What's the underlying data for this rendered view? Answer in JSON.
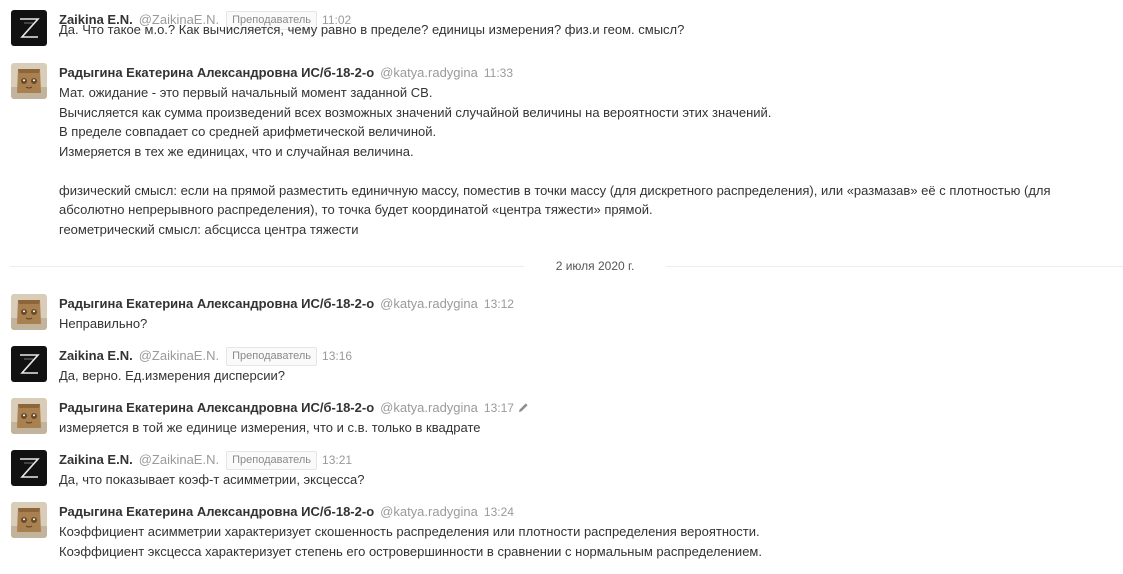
{
  "messages": [
    {
      "author": "Zaikina E.N.",
      "handle": "@ZaikinaE.N.",
      "role": "Преподаватель",
      "time": "11:02",
      "avatar": "teacher-logo-avatar",
      "lines": [
        "Да. Что такое м.о.? Как вычисляется, чему равно в пределе? единицы измерения? физ.и геом. смысл?"
      ]
    },
    {
      "author": "Радыгина Екатерина Александровна ИС/б-18-2-о",
      "handle": "@katya.radygina",
      "time": "11:33",
      "avatar": "student-photo-avatar",
      "lines": [
        "Мат. ожидание - это первый начальный момент заданной СВ.",
        "Вычисляется как сумма произведений всех возможных значений случайной величины на вероятности этих значений.",
        "В пределе совпадает со средней арифметической величиной.",
        "Измеряется в тех же единицах, что и случайная величина.",
        "",
        "физический смысл: если на прямой разместить единичную массу, поместив в точки массу (для дискретного распределения), или «размазав» её с плотностью (для",
        "абсолютно непрерывного распределения), то точка будет координатой «центра тяжести» прямой.",
        "геометрический смысл: абсцисса центра тяжести"
      ]
    },
    {
      "author": "Радыгина Екатерина Александровна ИС/б-18-2-о",
      "handle": "@katya.radygina",
      "time": "13:12",
      "avatar": "student-photo-avatar",
      "lines": [
        "Неправильно?"
      ]
    },
    {
      "author": "Zaikina E.N.",
      "handle": "@ZaikinaE.N.",
      "role": "Преподаватель",
      "time": "13:16",
      "avatar": "teacher-logo-avatar",
      "lines": [
        "Да, верно. Ед.измерения дисперсии?"
      ]
    },
    {
      "author": "Радыгина Екатерина Александровна ИС/б-18-2-о",
      "handle": "@katya.radygina",
      "time": "13:17",
      "edited": true,
      "avatar": "student-photo-avatar",
      "lines": [
        "измеряется в той же единице измерения, что и с.в. только в квадрате"
      ]
    },
    {
      "author": "Zaikina E.N.",
      "handle": "@ZaikinaE.N.",
      "role": "Преподаватель",
      "time": "13:21",
      "avatar": "teacher-logo-avatar",
      "lines": [
        "Да, что показывает коэф-т асимметрии, эксцесса?"
      ]
    },
    {
      "author": "Радыгина Екатерина Александровна ИС/б-18-2-о",
      "handle": "@katya.radygina",
      "time": "13:24",
      "avatar": "student-photo-avatar",
      "lines": [
        "Коэффициент асимметрии характеризует скошенность распределения или плотности распределения вероятности.",
        "Коэффициент эксцесса характеризует степень его островершинности в сравнении с нормальным распределением."
      ]
    }
  ],
  "date_divider": "2 июля 2020 г.",
  "colors": {
    "author": "#333333",
    "meta": "#9a9a9a",
    "role_border": "#e6e6e6"
  }
}
